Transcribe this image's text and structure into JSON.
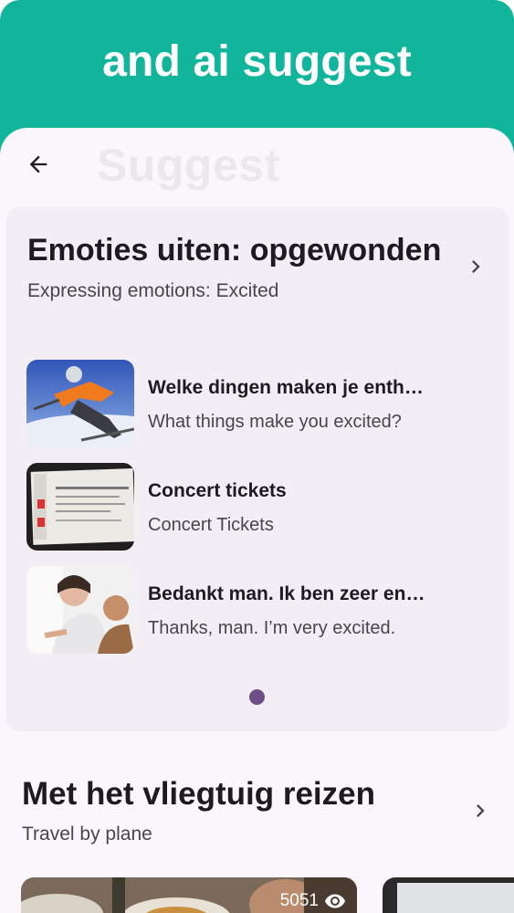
{
  "promo": {
    "title": "and ai suggest"
  },
  "appbar": {
    "ghost_title": "Suggest",
    "back_icon": "arrow-left-icon"
  },
  "featured": {
    "title": "Emoties uiten: opgewonden",
    "subtitle": "Expressing emotions: Excited",
    "items": [
      {
        "title": "Welke dingen maken je enthousiast?",
        "subtitle": "What things make you excited?",
        "thumb": "skier-photo"
      },
      {
        "title": "Concert tickets",
        "subtitle": "Concert Tickets",
        "thumb": "ticket-photo"
      },
      {
        "title": "Bedankt man. Ik ben zeer enthousiast.",
        "subtitle": "Thanks, man. I’m very excited.",
        "thumb": "people-photo"
      }
    ],
    "pager": {
      "pages": 1,
      "current": 1
    }
  },
  "section": {
    "title": "Met het vliegtuig reizen",
    "subtitle": "Travel by plane",
    "videos": [
      {
        "views": "5051",
        "icon": "eye-icon"
      }
    ]
  },
  "colors": {
    "brand": "#10b59c",
    "accent": "#6e4e87",
    "surface": "#fbf6fb",
    "card": "#f3eef5"
  }
}
